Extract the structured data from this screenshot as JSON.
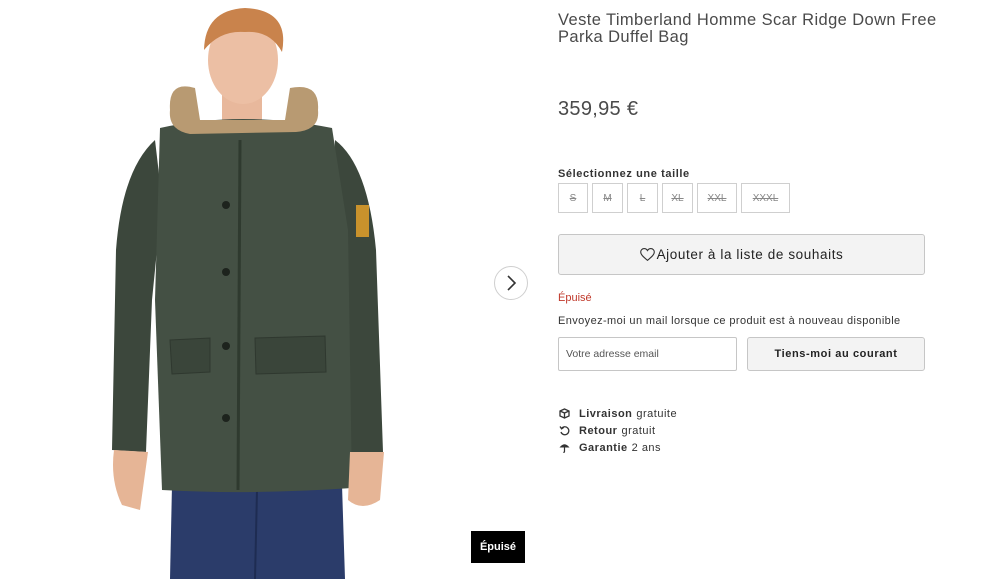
{
  "product": {
    "title": "Veste Timberland Homme Scar Ridge Down Free Parka Duffel Bag",
    "price": "359,95 €",
    "image_alt": "Model wearing dark green parka with fur-trimmed hood"
  },
  "gallery": {
    "next_icon": "chevron-right-icon",
    "badge": "Épuisé"
  },
  "size_selector": {
    "label": "Sélectionnez une taille",
    "sizes": [
      "S",
      "M",
      "L",
      "XL",
      "XXL",
      "XXXL"
    ]
  },
  "wishlist": {
    "icon": "heart-outline-icon",
    "label": "Ajouter à la liste de souhaits"
  },
  "availability": {
    "status": "Épuisé",
    "status_color": "#c0392b"
  },
  "notify": {
    "text": "Envoyez-moi un mail lorsque ce produit est à nouveau disponible",
    "email_placeholder": "Votre adresse email",
    "button": "Tiens-moi au courant"
  },
  "perks": [
    {
      "icon": "delivery-icon",
      "bold": "Livraison",
      "rest": "gratuite"
    },
    {
      "icon": "return-icon",
      "bold": "Retour",
      "rest": "gratuit"
    },
    {
      "icon": "umbrella-icon",
      "bold": "Garantie",
      "rest": "2 ans"
    }
  ],
  "colors": {
    "jacket": "#3f4b3f",
    "badge_bg": "#000000",
    "button_bg": "#f3f3f3"
  }
}
